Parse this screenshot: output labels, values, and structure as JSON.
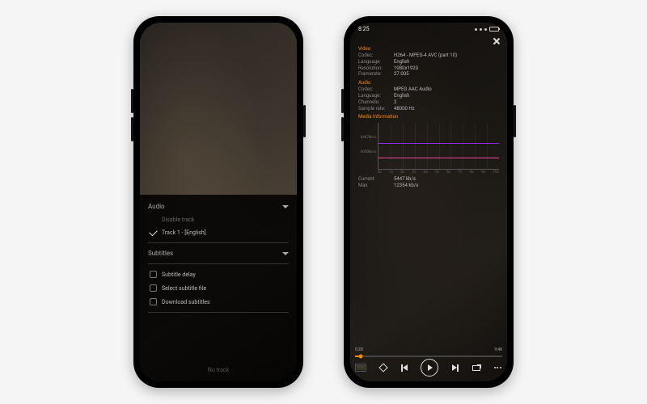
{
  "left": {
    "audio": {
      "header": "Audio",
      "disable": "Disable track",
      "track1": "Track 1 - [English]"
    },
    "subtitles": {
      "header": "Subtitles",
      "delay": "Subtitle delay",
      "select": "Select subtitle file",
      "download": "Download subtitles"
    },
    "footer": "No track"
  },
  "right": {
    "status": {
      "time": "8:25"
    },
    "video": {
      "heading": "Video",
      "codec_label": "Codec:",
      "codec": "H264 - MPEG-4 AVC (part 10)",
      "language_label": "Language:",
      "language": "English",
      "resolution_label": "Resolution:",
      "resolution": "1080x1920",
      "framerate_label": "Framerate:",
      "framerate": "27.005"
    },
    "audio": {
      "heading": "Audio",
      "codec_label": "Codec:",
      "codec": "MPEG AAC Audio",
      "language_label": "Language:",
      "language": "English",
      "channels_label": "Channels:",
      "channels": "2",
      "samplerate_label": "Sample rate:",
      "samplerate": "48000 Hz"
    },
    "perf": {
      "heading": "Media Information",
      "y_hi": "6447kb/s",
      "y_lo": "6000kb/s",
      "current_label": "Current",
      "current": "5447 kb/s",
      "max_label": "Max",
      "max": "12354 kb/s"
    },
    "player": {
      "cur": "0:20",
      "dur": "9:48"
    }
  },
  "chart_data": {
    "type": "line",
    "x_ticks": [
      "0s",
      "-1s",
      "-2s",
      "-3s",
      "-4s",
      "-5s",
      "-6s",
      "-7s",
      "-8s",
      "-9s",
      "-10s"
    ],
    "ylim": [
      0,
      13000
    ],
    "ylabels": [
      "6447kb/s",
      "6000kb/s"
    ],
    "series": [
      {
        "name": "current",
        "color": "#ff3fa0",
        "flat_value": 5447
      },
      {
        "name": "max",
        "color": "#8a2be2",
        "flat_value": 12354
      }
    ]
  }
}
